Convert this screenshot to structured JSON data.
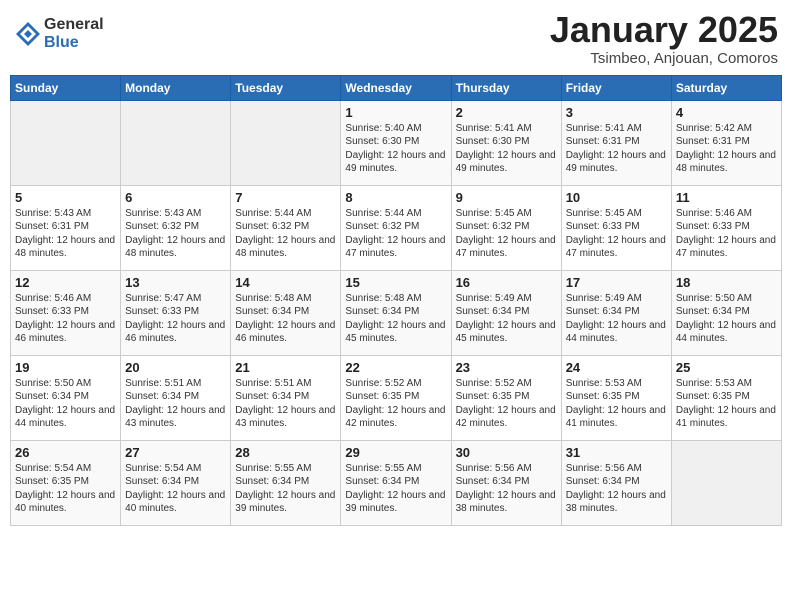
{
  "logo": {
    "general": "General",
    "blue": "Blue"
  },
  "title": "January 2025",
  "subtitle": "Tsimbeo, Anjouan, Comoros",
  "days_of_week": [
    "Sunday",
    "Monday",
    "Tuesday",
    "Wednesday",
    "Thursday",
    "Friday",
    "Saturday"
  ],
  "weeks": [
    [
      {
        "day": "",
        "info": ""
      },
      {
        "day": "",
        "info": ""
      },
      {
        "day": "",
        "info": ""
      },
      {
        "day": "1",
        "info": "Sunrise: 5:40 AM\nSunset: 6:30 PM\nDaylight: 12 hours\nand 49 minutes."
      },
      {
        "day": "2",
        "info": "Sunrise: 5:41 AM\nSunset: 6:30 PM\nDaylight: 12 hours\nand 49 minutes."
      },
      {
        "day": "3",
        "info": "Sunrise: 5:41 AM\nSunset: 6:31 PM\nDaylight: 12 hours\nand 49 minutes."
      },
      {
        "day": "4",
        "info": "Sunrise: 5:42 AM\nSunset: 6:31 PM\nDaylight: 12 hours\nand 48 minutes."
      }
    ],
    [
      {
        "day": "5",
        "info": "Sunrise: 5:43 AM\nSunset: 6:31 PM\nDaylight: 12 hours\nand 48 minutes."
      },
      {
        "day": "6",
        "info": "Sunrise: 5:43 AM\nSunset: 6:32 PM\nDaylight: 12 hours\nand 48 minutes."
      },
      {
        "day": "7",
        "info": "Sunrise: 5:44 AM\nSunset: 6:32 PM\nDaylight: 12 hours\nand 48 minutes."
      },
      {
        "day": "8",
        "info": "Sunrise: 5:44 AM\nSunset: 6:32 PM\nDaylight: 12 hours\nand 47 minutes."
      },
      {
        "day": "9",
        "info": "Sunrise: 5:45 AM\nSunset: 6:32 PM\nDaylight: 12 hours\nand 47 minutes."
      },
      {
        "day": "10",
        "info": "Sunrise: 5:45 AM\nSunset: 6:33 PM\nDaylight: 12 hours\nand 47 minutes."
      },
      {
        "day": "11",
        "info": "Sunrise: 5:46 AM\nSunset: 6:33 PM\nDaylight: 12 hours\nand 47 minutes."
      }
    ],
    [
      {
        "day": "12",
        "info": "Sunrise: 5:46 AM\nSunset: 6:33 PM\nDaylight: 12 hours\nand 46 minutes."
      },
      {
        "day": "13",
        "info": "Sunrise: 5:47 AM\nSunset: 6:33 PM\nDaylight: 12 hours\nand 46 minutes."
      },
      {
        "day": "14",
        "info": "Sunrise: 5:48 AM\nSunset: 6:34 PM\nDaylight: 12 hours\nand 46 minutes."
      },
      {
        "day": "15",
        "info": "Sunrise: 5:48 AM\nSunset: 6:34 PM\nDaylight: 12 hours\nand 45 minutes."
      },
      {
        "day": "16",
        "info": "Sunrise: 5:49 AM\nSunset: 6:34 PM\nDaylight: 12 hours\nand 45 minutes."
      },
      {
        "day": "17",
        "info": "Sunrise: 5:49 AM\nSunset: 6:34 PM\nDaylight: 12 hours\nand 44 minutes."
      },
      {
        "day": "18",
        "info": "Sunrise: 5:50 AM\nSunset: 6:34 PM\nDaylight: 12 hours\nand 44 minutes."
      }
    ],
    [
      {
        "day": "19",
        "info": "Sunrise: 5:50 AM\nSunset: 6:34 PM\nDaylight: 12 hours\nand 44 minutes."
      },
      {
        "day": "20",
        "info": "Sunrise: 5:51 AM\nSunset: 6:34 PM\nDaylight: 12 hours\nand 43 minutes."
      },
      {
        "day": "21",
        "info": "Sunrise: 5:51 AM\nSunset: 6:34 PM\nDaylight: 12 hours\nand 43 minutes."
      },
      {
        "day": "22",
        "info": "Sunrise: 5:52 AM\nSunset: 6:35 PM\nDaylight: 12 hours\nand 42 minutes."
      },
      {
        "day": "23",
        "info": "Sunrise: 5:52 AM\nSunset: 6:35 PM\nDaylight: 12 hours\nand 42 minutes."
      },
      {
        "day": "24",
        "info": "Sunrise: 5:53 AM\nSunset: 6:35 PM\nDaylight: 12 hours\nand 41 minutes."
      },
      {
        "day": "25",
        "info": "Sunrise: 5:53 AM\nSunset: 6:35 PM\nDaylight: 12 hours\nand 41 minutes."
      }
    ],
    [
      {
        "day": "26",
        "info": "Sunrise: 5:54 AM\nSunset: 6:35 PM\nDaylight: 12 hours\nand 40 minutes."
      },
      {
        "day": "27",
        "info": "Sunrise: 5:54 AM\nSunset: 6:34 PM\nDaylight: 12 hours\nand 40 minutes."
      },
      {
        "day": "28",
        "info": "Sunrise: 5:55 AM\nSunset: 6:34 PM\nDaylight: 12 hours\nand 39 minutes."
      },
      {
        "day": "29",
        "info": "Sunrise: 5:55 AM\nSunset: 6:34 PM\nDaylight: 12 hours\nand 39 minutes."
      },
      {
        "day": "30",
        "info": "Sunrise: 5:56 AM\nSunset: 6:34 PM\nDaylight: 12 hours\nand 38 minutes."
      },
      {
        "day": "31",
        "info": "Sunrise: 5:56 AM\nSunset: 6:34 PM\nDaylight: 12 hours\nand 38 minutes."
      },
      {
        "day": "",
        "info": ""
      }
    ]
  ]
}
